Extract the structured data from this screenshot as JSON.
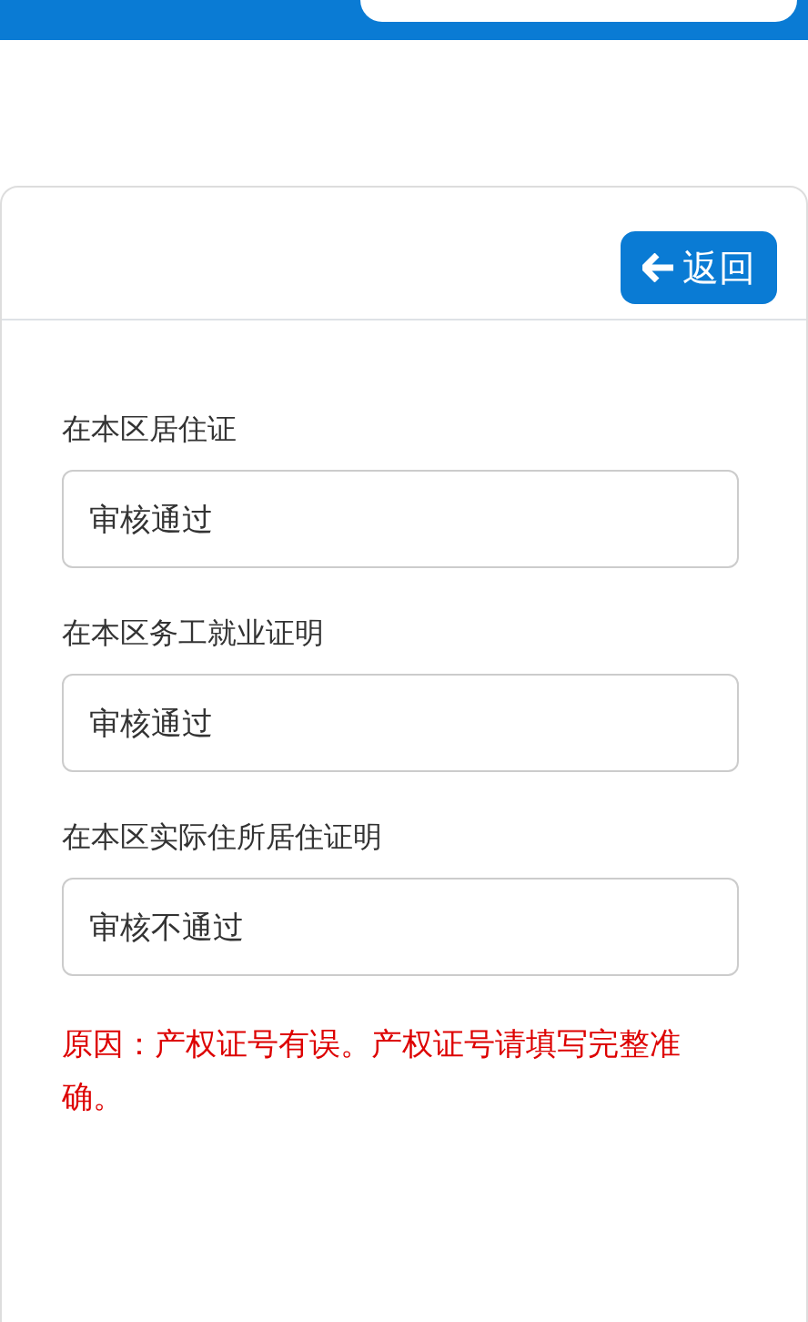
{
  "back_button": {
    "label": "返回"
  },
  "items": [
    {
      "label": "在本区居住证",
      "value": "审核通过"
    },
    {
      "label": "在本区务工就业证明",
      "value": "审核通过"
    },
    {
      "label": "在本区实际住所居住证明",
      "value": "审核不通过"
    }
  ],
  "reason": "原因：产权证号有误。产权证号请填写完整准确。"
}
